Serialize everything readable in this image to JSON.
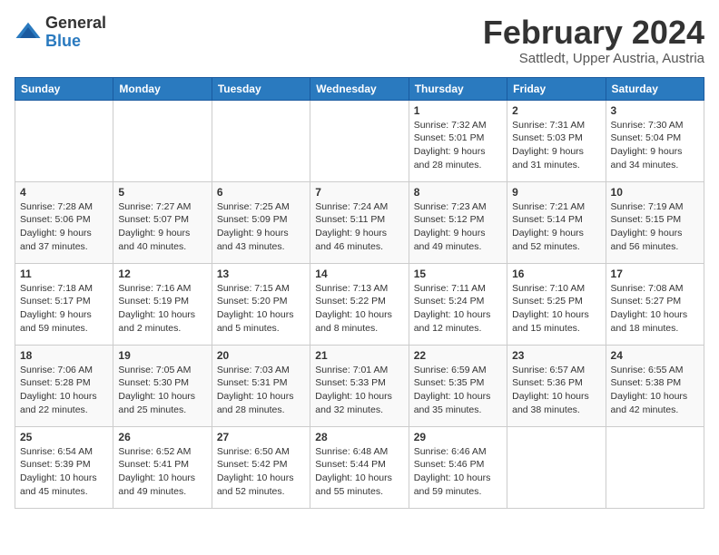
{
  "logo": {
    "general": "General",
    "blue": "Blue"
  },
  "title": "February 2024",
  "location": "Sattledt, Upper Austria, Austria",
  "weekdays": [
    "Sunday",
    "Monday",
    "Tuesday",
    "Wednesday",
    "Thursday",
    "Friday",
    "Saturday"
  ],
  "weeks": [
    [
      {
        "day": "",
        "info": ""
      },
      {
        "day": "",
        "info": ""
      },
      {
        "day": "",
        "info": ""
      },
      {
        "day": "",
        "info": ""
      },
      {
        "day": "1",
        "info": "Sunrise: 7:32 AM\nSunset: 5:01 PM\nDaylight: 9 hours\nand 28 minutes."
      },
      {
        "day": "2",
        "info": "Sunrise: 7:31 AM\nSunset: 5:03 PM\nDaylight: 9 hours\nand 31 minutes."
      },
      {
        "day": "3",
        "info": "Sunrise: 7:30 AM\nSunset: 5:04 PM\nDaylight: 9 hours\nand 34 minutes."
      }
    ],
    [
      {
        "day": "4",
        "info": "Sunrise: 7:28 AM\nSunset: 5:06 PM\nDaylight: 9 hours\nand 37 minutes."
      },
      {
        "day": "5",
        "info": "Sunrise: 7:27 AM\nSunset: 5:07 PM\nDaylight: 9 hours\nand 40 minutes."
      },
      {
        "day": "6",
        "info": "Sunrise: 7:25 AM\nSunset: 5:09 PM\nDaylight: 9 hours\nand 43 minutes."
      },
      {
        "day": "7",
        "info": "Sunrise: 7:24 AM\nSunset: 5:11 PM\nDaylight: 9 hours\nand 46 minutes."
      },
      {
        "day": "8",
        "info": "Sunrise: 7:23 AM\nSunset: 5:12 PM\nDaylight: 9 hours\nand 49 minutes."
      },
      {
        "day": "9",
        "info": "Sunrise: 7:21 AM\nSunset: 5:14 PM\nDaylight: 9 hours\nand 52 minutes."
      },
      {
        "day": "10",
        "info": "Sunrise: 7:19 AM\nSunset: 5:15 PM\nDaylight: 9 hours\nand 56 minutes."
      }
    ],
    [
      {
        "day": "11",
        "info": "Sunrise: 7:18 AM\nSunset: 5:17 PM\nDaylight: 9 hours\nand 59 minutes."
      },
      {
        "day": "12",
        "info": "Sunrise: 7:16 AM\nSunset: 5:19 PM\nDaylight: 10 hours\nand 2 minutes."
      },
      {
        "day": "13",
        "info": "Sunrise: 7:15 AM\nSunset: 5:20 PM\nDaylight: 10 hours\nand 5 minutes."
      },
      {
        "day": "14",
        "info": "Sunrise: 7:13 AM\nSunset: 5:22 PM\nDaylight: 10 hours\nand 8 minutes."
      },
      {
        "day": "15",
        "info": "Sunrise: 7:11 AM\nSunset: 5:24 PM\nDaylight: 10 hours\nand 12 minutes."
      },
      {
        "day": "16",
        "info": "Sunrise: 7:10 AM\nSunset: 5:25 PM\nDaylight: 10 hours\nand 15 minutes."
      },
      {
        "day": "17",
        "info": "Sunrise: 7:08 AM\nSunset: 5:27 PM\nDaylight: 10 hours\nand 18 minutes."
      }
    ],
    [
      {
        "day": "18",
        "info": "Sunrise: 7:06 AM\nSunset: 5:28 PM\nDaylight: 10 hours\nand 22 minutes."
      },
      {
        "day": "19",
        "info": "Sunrise: 7:05 AM\nSunset: 5:30 PM\nDaylight: 10 hours\nand 25 minutes."
      },
      {
        "day": "20",
        "info": "Sunrise: 7:03 AM\nSunset: 5:31 PM\nDaylight: 10 hours\nand 28 minutes."
      },
      {
        "day": "21",
        "info": "Sunrise: 7:01 AM\nSunset: 5:33 PM\nDaylight: 10 hours\nand 32 minutes."
      },
      {
        "day": "22",
        "info": "Sunrise: 6:59 AM\nSunset: 5:35 PM\nDaylight: 10 hours\nand 35 minutes."
      },
      {
        "day": "23",
        "info": "Sunrise: 6:57 AM\nSunset: 5:36 PM\nDaylight: 10 hours\nand 38 minutes."
      },
      {
        "day": "24",
        "info": "Sunrise: 6:55 AM\nSunset: 5:38 PM\nDaylight: 10 hours\nand 42 minutes."
      }
    ],
    [
      {
        "day": "25",
        "info": "Sunrise: 6:54 AM\nSunset: 5:39 PM\nDaylight: 10 hours\nand 45 minutes."
      },
      {
        "day": "26",
        "info": "Sunrise: 6:52 AM\nSunset: 5:41 PM\nDaylight: 10 hours\nand 49 minutes."
      },
      {
        "day": "27",
        "info": "Sunrise: 6:50 AM\nSunset: 5:42 PM\nDaylight: 10 hours\nand 52 minutes."
      },
      {
        "day": "28",
        "info": "Sunrise: 6:48 AM\nSunset: 5:44 PM\nDaylight: 10 hours\nand 55 minutes."
      },
      {
        "day": "29",
        "info": "Sunrise: 6:46 AM\nSunset: 5:46 PM\nDaylight: 10 hours\nand 59 minutes."
      },
      {
        "day": "",
        "info": ""
      },
      {
        "day": "",
        "info": ""
      }
    ]
  ]
}
